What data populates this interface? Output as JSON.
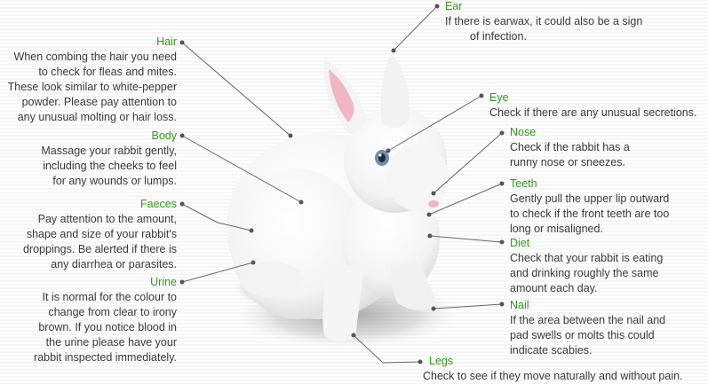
{
  "colors": {
    "title": "#2f9a17",
    "text": "#3a3a3a",
    "leader": "#666666",
    "bunny": "#ffffff",
    "bunny_shadow": "#d8d8d8",
    "ear_inner": "#f0b7c3",
    "eye": "#6c8fb0"
  },
  "illustration": {
    "subject": "white rabbit",
    "icon": "rabbit-illustration"
  },
  "callouts": {
    "ear": {
      "title": "Ear",
      "text": "If there is earwax, it could also be a sign\nof infection."
    },
    "hair": {
      "title": "Hair",
      "text": "When combing the hair you need\nto check for fleas and mites.\nThese look similar to white-pepper\npowder.  Please pay attention to\nany unusual molting or hair loss."
    },
    "eye": {
      "title": "Eye",
      "text": "Check if there are any unusual secretions."
    },
    "body": {
      "title": "Body",
      "text": "Massage your rabbit gently,\nincluding the cheeks to feel\nfor any wounds or lumps."
    },
    "nose": {
      "title": "Nose",
      "text": "Check if the rabbit has a\nrunny nose or sneezes."
    },
    "teeth": {
      "title": "Teeth",
      "text": "Gently pull the upper lip outward\nto check if the front teeth are too\nlong or misaligned."
    },
    "faeces": {
      "title": "Faeces",
      "text": "Pay attention to the amount,\nshape and size of your rabbit's\ndroppings.  Be alerted if there is\nany diarrhea or parasites."
    },
    "diet": {
      "title": "Diet",
      "text": "Check that your rabbit is eating\nand drinking roughly the same\namount each day."
    },
    "urine": {
      "title": "Urine",
      "text": "It is normal for the colour to\nchange from clear to irony\nbrown.  If you notice blood in\nthe urine please have your\nrabbit inspected immediately."
    },
    "nail": {
      "title": "Nail",
      "text": "If the area between the nail and\npad swells or molts this could\nindicate scabies."
    },
    "legs": {
      "title": "Legs",
      "text": "Check to see if they move naturally and without pain."
    }
  }
}
